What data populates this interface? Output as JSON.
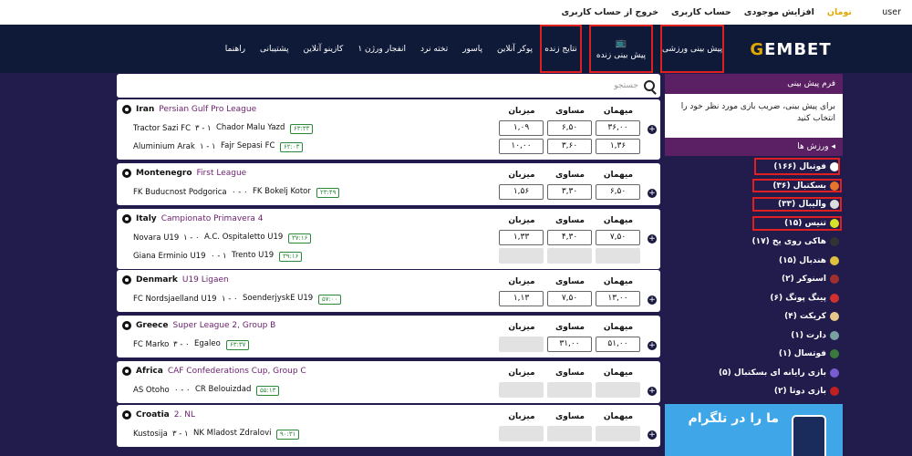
{
  "topbar": {
    "user": "user",
    "currency": "تومان",
    "links": [
      "افزایش موجودی",
      "حساب کاربری",
      "خروج از حساب کاربری"
    ]
  },
  "logo": {
    "a": "G",
    "b": "EMBET"
  },
  "menu": [
    {
      "label": "پیش بینی ورزشی",
      "highlight": true
    },
    {
      "label": "پیش بینی زنده",
      "highlight": true,
      "icon": "tv-icon"
    },
    {
      "label": "نتایج زنده",
      "highlight": true
    },
    {
      "label": "پوکر آنلاین"
    },
    {
      "label": "پاسور"
    },
    {
      "label": "تخته نرد"
    },
    {
      "label": "انفجار ورژن ۱"
    },
    {
      "label": "کازینو آنلاین"
    },
    {
      "label": "پشتیبانی"
    },
    {
      "label": "راهنما"
    }
  ],
  "search": {
    "placeholder": "جستجو"
  },
  "headers": {
    "away": "میهمان",
    "draw": "مساوی",
    "home": "میزبان"
  },
  "leagues": [
    {
      "country": "Iran",
      "league": "Persian Gulf Pro League",
      "matches": [
        {
          "home": "Tractor Sazi FC",
          "score": "۳ - ۱",
          "away": "Chador Malu Yazd",
          "time": "۶۳:۳۳",
          "odds": [
            "۳۶,۰۰",
            "۶,۵۰",
            "۱,۰۹"
          ]
        },
        {
          "home": "Aluminium Arak",
          "score": "۱ - ۱",
          "away": "Fajr Sepasi FC",
          "time": "۶۲:۰۳",
          "odds": [
            "۱,۳۶",
            "۳,۶۰",
            "۱۰,۰۰"
          ]
        }
      ]
    },
    {
      "country": "Montenegro",
      "league": "First League",
      "matches": [
        {
          "home": "FK Buducnost Podgorica",
          "score": "۰ - ۰",
          "away": "FK Bokelj Kotor",
          "time": "۲۳:۴۹",
          "odds": [
            "۶,۵۰",
            "۳,۳۰",
            "۱,۵۶"
          ]
        }
      ]
    },
    {
      "country": "Italy",
      "league": "Campionato Primavera 4",
      "matches": [
        {
          "home": "Novara U19",
          "score": "۱ - ۰",
          "away": "A.C. Ospitaletto U19",
          "time": "۳۷:۱۶",
          "odds": [
            "۷,۵۰",
            "۴,۳۰",
            "۱,۳۳"
          ]
        },
        {
          "home": "Giana Erminio U19",
          "score": "۰ - ۱",
          "away": "Trento U19",
          "time": "۳۹:۱۶",
          "odds": [
            "",
            "",
            ""
          ]
        }
      ]
    },
    {
      "country": "Denmark",
      "league": "U19 Ligaen",
      "matches": [
        {
          "home": "FC Nordsjaelland U19",
          "score": "۱ - ۰",
          "away": "SoenderjyskE U19",
          "time": "۵۷:۰۰",
          "odds": [
            "۱۳,۰۰",
            "۷,۵۰",
            "۱,۱۳"
          ]
        }
      ]
    },
    {
      "country": "Greece",
      "league": "Super League 2, Group B",
      "matches": [
        {
          "home": "FC Marko",
          "score": "۳ - ۰",
          "away": "Egaleo",
          "time": "۶۳:۳۷",
          "odds": [
            "۵۱,۰۰",
            "۳۱,۰۰",
            ""
          ]
        }
      ]
    },
    {
      "country": "Africa",
      "league": "CAF Confederations Cup, Group C",
      "matches": [
        {
          "home": "AS Otoho",
          "score": "۰ - ۰",
          "away": "CR Belouizdad",
          "time": "۵۵:۱۳",
          "odds": [
            "",
            "",
            ""
          ]
        }
      ]
    },
    {
      "country": "Croatia",
      "league": "2. NL",
      "matches": [
        {
          "home": "Kustosija",
          "score": "۳ - ۱",
          "away": "NK Mladost Zdralovi",
          "time": "۹۰:۳۱",
          "odds": [
            "",
            "",
            ""
          ]
        }
      ]
    }
  ],
  "sidebar": {
    "form_title": "فرم پیش بینی",
    "form_msg": "برای پیش بینی، ضریب بازی مورد نظر خود را انتخاب کنید",
    "sports_title": "ورزش ها",
    "sports": [
      {
        "label": "فوتبال (۱۶۶)",
        "color": "#ffffff"
      },
      {
        "label": "بسکتبال (۳۶)",
        "color": "#e8732a"
      },
      {
        "label": "والیبال (۳۳)",
        "color": "#dcdcdc"
      },
      {
        "label": "تنیس (۱۵)",
        "color": "#d7e12a"
      },
      {
        "label": "هاکی روی یخ (۱۷)",
        "color": "#333333"
      },
      {
        "label": "هندبال (۱۵)",
        "color": "#e0c040"
      },
      {
        "label": "اسنوکر (۲)",
        "color": "#a03030"
      },
      {
        "label": "پینگ پونگ (۶)",
        "color": "#d03030"
      },
      {
        "label": "کریکت (۴)",
        "color": "#e6c88a"
      },
      {
        "label": "دارت (۱)",
        "color": "#7aa0a0"
      },
      {
        "label": "فوتسال (۱)",
        "color": "#3a7a3a"
      },
      {
        "label": "بازی رایانه ای بسکتبال (۵)",
        "color": "#7a5cd0"
      },
      {
        "label": "بازی دوتا (۲)",
        "color": "#c02020"
      }
    ],
    "banner_text": "ما را در تلگرام"
  }
}
